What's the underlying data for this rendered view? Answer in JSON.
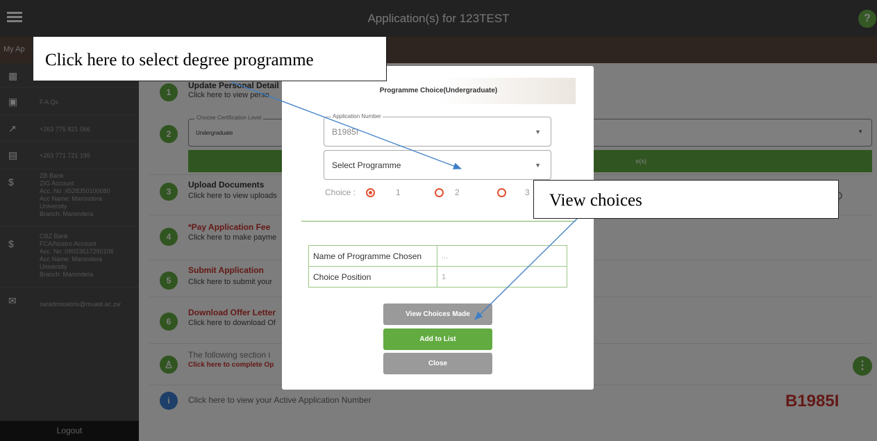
{
  "header": {
    "title": "Application(s) for 123TEST",
    "help_label": "?"
  },
  "subbar": {
    "text": "My Ap"
  },
  "sidebar": {
    "faq": "F.A.Qs",
    "phone1": "+263 775 821 066",
    "phone2": "+263 771 721 195",
    "bank1": "ZB Bank\nZIG Account\nAcc. No :4528350100080\nAcc Name: Marondera\nUniversity\nBranch: Marondera",
    "bank2": "CBZ Bank\nFCA/Nostro Account\nAcc. No :09023617290106\nAcc Name: Marondera\nUniversity\nBranch: Marondera",
    "email": "saradmissions@muast.ac.zw",
    "logout": "Logout"
  },
  "steps": [
    {
      "num": "1",
      "title": "Update Personal Detail",
      "sub": "Click here to view perso"
    },
    {
      "num": "2",
      "cert_legend": "Choose Certification Level",
      "cert_value": "Undergraduate",
      "bar_text": "e(s)"
    },
    {
      "num": "3",
      "title": "Upload Documents",
      "sub": "Click here to view uploads"
    },
    {
      "num": "4",
      "title": "*Pay  Application Fee",
      "sub": "Click here to make payme"
    },
    {
      "num": "5",
      "title": "Submit Application",
      "sub": "Click here to submit your"
    },
    {
      "num": "6",
      "title": "Download Offer Letter",
      "sub": "Click here to download Of"
    },
    {
      "title": "The following section i",
      "sub": "Click here to complete Op"
    }
  ],
  "active_app": {
    "text": "Click here to view your Active Application Number",
    "number": "B1985I"
  },
  "modal": {
    "title": "Programme Choice(Undergraduate)",
    "app_number_legend": "Application Number",
    "app_number_value": "B1985I",
    "programme_placeholder": "Select Programme",
    "choice_label": "Choice :",
    "choices": [
      "1",
      "2",
      "3"
    ],
    "selected_choice": "1",
    "table": [
      {
        "label": "Name of Programme Chosen",
        "value": "..."
      },
      {
        "label": "Choice Position",
        "value": "1"
      }
    ],
    "buttons": {
      "view": "View Choices Made",
      "add": "Add to List",
      "close": "Close"
    }
  },
  "annotations": {
    "callout1": "Click here to select degree programme",
    "callout2": "View choices"
  },
  "colors": {
    "accent_green": "#62ab41",
    "danger_red": "#c8322f",
    "radio_orange": "#e05130",
    "arrow_blue": "#3e7fc7"
  }
}
